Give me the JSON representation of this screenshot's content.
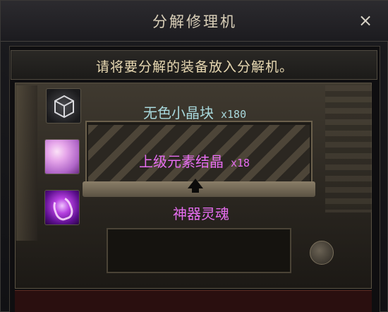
{
  "window": {
    "title": "分解修理机",
    "close_label": "×"
  },
  "instruction": "请将要分解的装备放入分解机。",
  "items": [
    {
      "name": "无色小晶块",
      "quantity": "x180",
      "icon": "colorless-crystal-icon",
      "color": "#a8d8dc"
    },
    {
      "name": "上级元素结晶",
      "quantity": "x18",
      "icon": "element-crystal-icon",
      "color": "#e66df0"
    },
    {
      "name": "神器灵魂",
      "quantity": "",
      "icon": "artifact-soul-icon",
      "color": "#e66df0"
    }
  ]
}
